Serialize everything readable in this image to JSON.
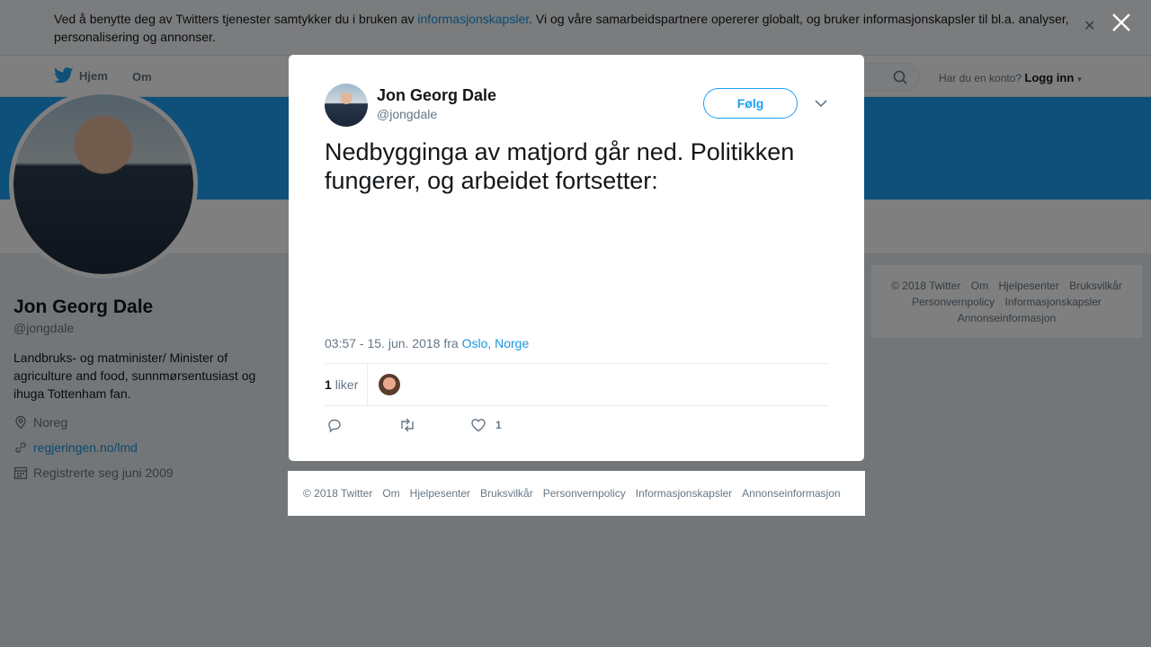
{
  "cookie": {
    "text_before": "Ved å benytte deg av Twitters tjenester samtykker du i bruken av ",
    "link": "informasjonskapsler",
    "text_after": ". Vi og våre samarbeidspartnere opererer globalt, og bruker informasjonskapsler til bl.a. analyser, personalisering og annonser."
  },
  "nav": {
    "home": "Hjem",
    "about": "Om",
    "login_question": "Har du en konto?",
    "login": "Logg inn"
  },
  "profile": {
    "name": "Jon Georg Dale",
    "handle": "@jongdale",
    "bio": "Landbruks- og matminister/ Minister of agriculture and food, sunnmørsentusiast og ihuga Tottenham fan.",
    "location": "Noreg",
    "website": "regjeringen.no/lmd",
    "joined": "Registrerte seg juni 2009"
  },
  "side_footer": {
    "items": [
      "© 2018 Twitter",
      "Om",
      "Hjelpesenter",
      "Bruksvilkår",
      "Personvernpolicy",
      "Informasjonskapsler",
      "Annonseinformasjon"
    ]
  },
  "tweet": {
    "author_name": "Jon Georg Dale",
    "author_handle": "@jongdale",
    "follow_label": "Følg",
    "text": "Nedbygginga av matjord går ned. Politikken fungerer, og arbeidet fortsetter:",
    "timestamp": "03:57 - 15. jun. 2018 fra ",
    "location": "Oslo, Norge",
    "likes_count": "1",
    "likes_label": "liker",
    "action_like_count": "1"
  },
  "modal_footer": {
    "items": [
      "© 2018 Twitter",
      "Om",
      "Hjelpesenter",
      "Bruksvilkår",
      "Personvernpolicy",
      "Informasjonskapsler",
      "Annonseinformasjon"
    ]
  },
  "colors": {
    "brand_blue": "#1da1f2",
    "link_blue": "#1b95e0",
    "muted": "#657786"
  }
}
